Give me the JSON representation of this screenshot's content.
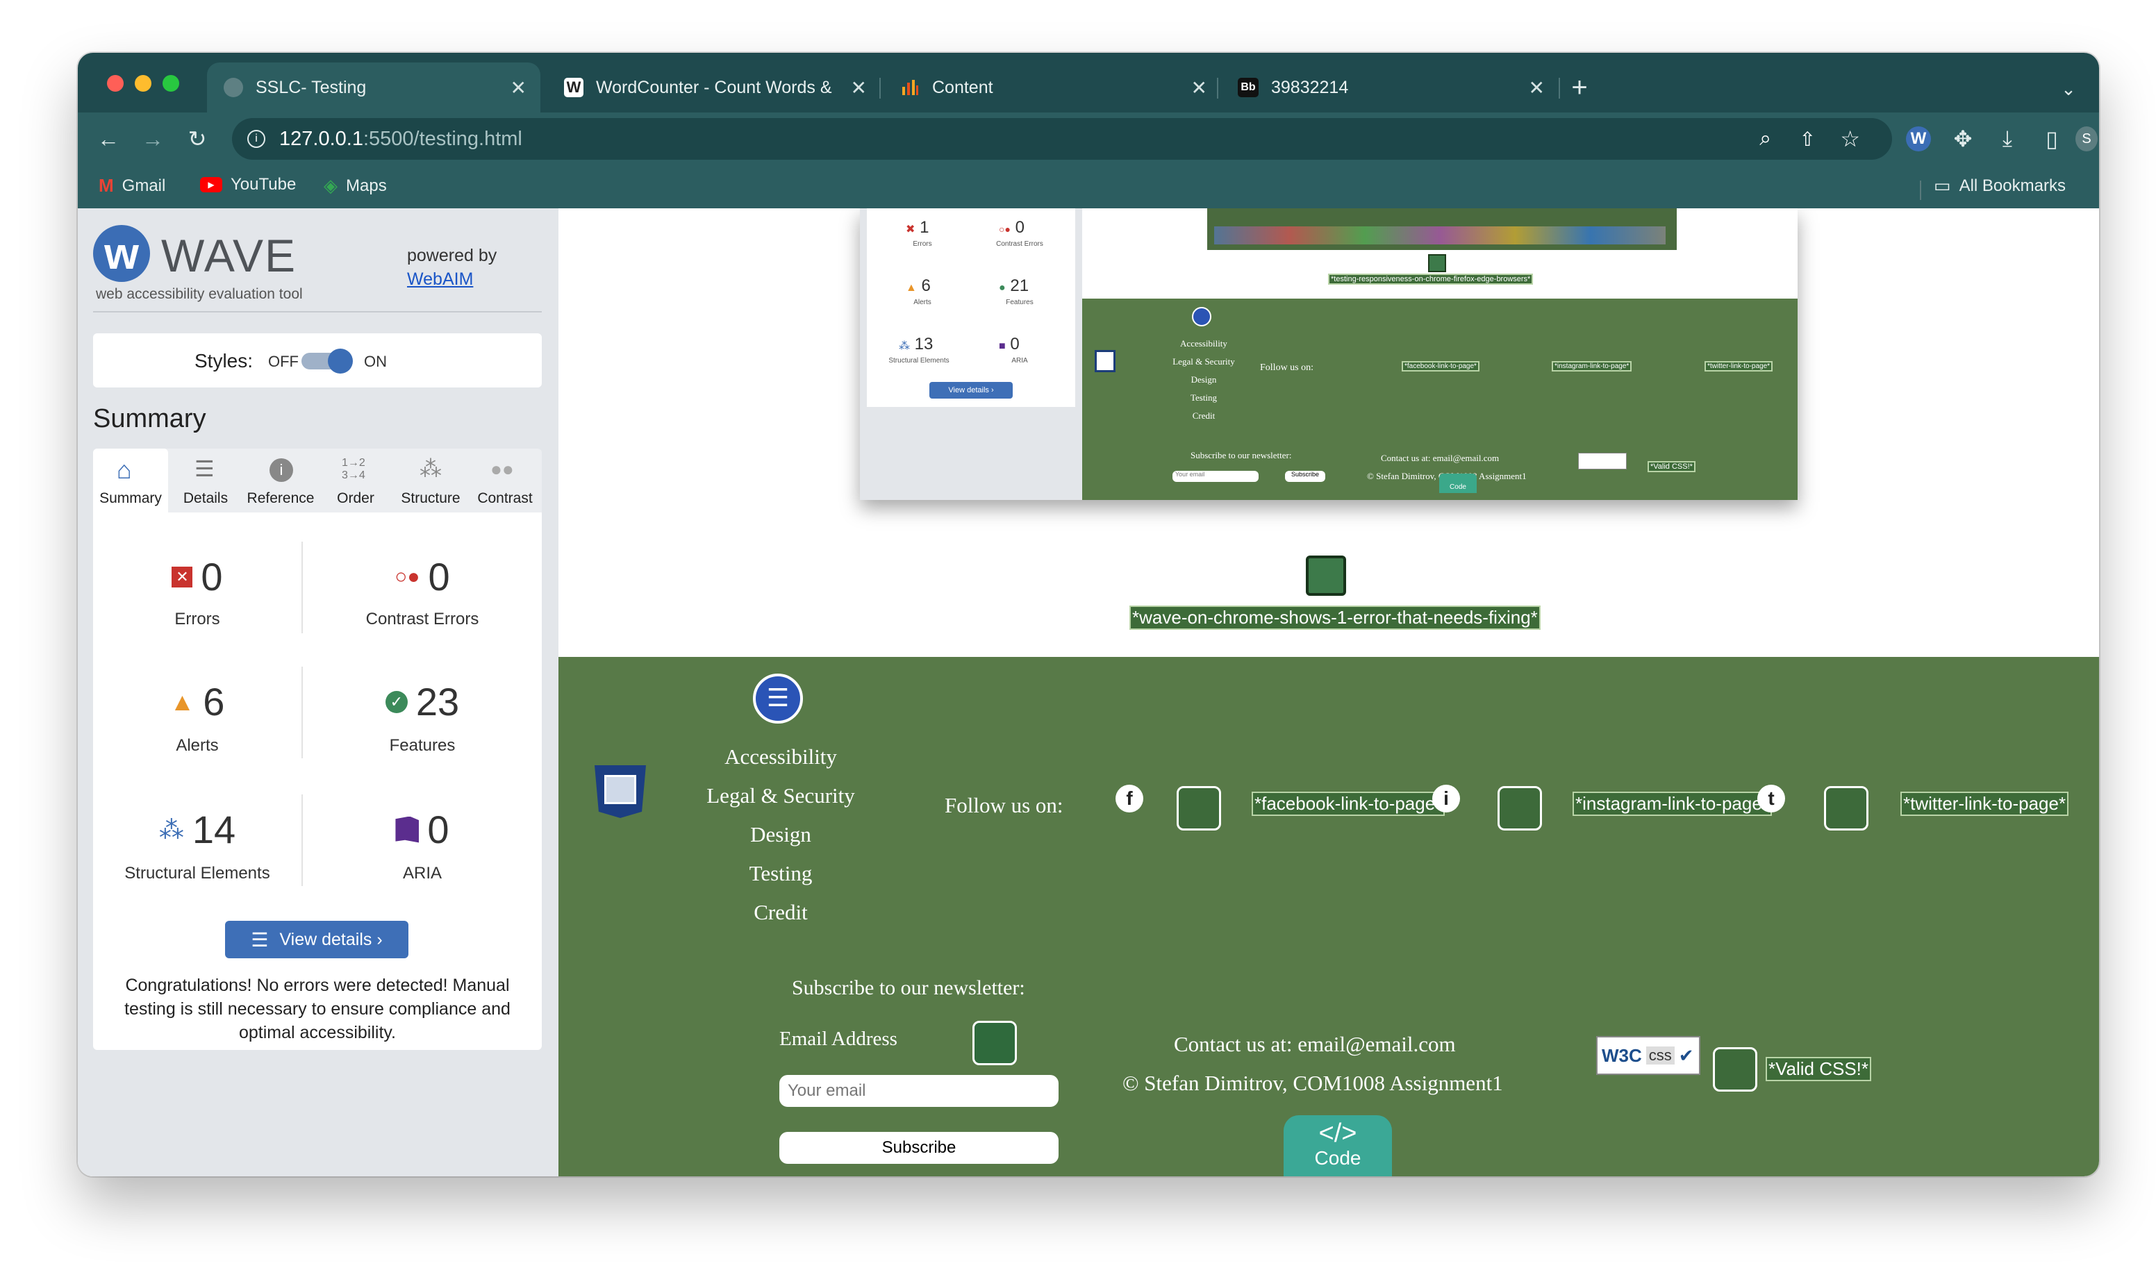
{
  "browser": {
    "tabs": [
      {
        "label": "SSLC- Testing",
        "active": true
      },
      {
        "label": "WordCounter - Count Words &",
        "active": false
      },
      {
        "label": "Content",
        "active": false
      },
      {
        "label": "39832214",
        "active": false
      }
    ],
    "new_tab": "+",
    "url": "127.0.0.1:5500/testing.html",
    "url_host": "127.0.0.1",
    "url_rest": ":5500/testing.html",
    "profile_initial": "S",
    "bookmarks": [
      "Gmail",
      "YouTube",
      "Maps"
    ],
    "all_bookmarks": "All Bookmarks"
  },
  "wave": {
    "logo": "WAVE",
    "tagline": "web accessibility evaluation tool",
    "powered_by": "powered by",
    "webaim": "WebAIM",
    "styles_label": "Styles:",
    "styles_off": "OFF",
    "styles_on": "ON",
    "summary_title": "Summary",
    "tabs": [
      "Summary",
      "Details",
      "Reference",
      "Order",
      "Structure",
      "Contrast"
    ],
    "counts": {
      "errors": {
        "value": "0",
        "label": "Errors"
      },
      "contrast": {
        "value": "0",
        "label": "Contrast Errors"
      },
      "alerts": {
        "value": "6",
        "label": "Alerts"
      },
      "features": {
        "value": "23",
        "label": "Features"
      },
      "structural": {
        "value": "14",
        "label": "Structural Elements"
      },
      "aria": {
        "value": "0",
        "label": "ARIA"
      }
    },
    "view_details": "View details ›",
    "message": "Congratulations! No errors were detected! Manual testing is still necessary to ensure compliance and optimal accessibility."
  },
  "screenshot_thumb": {
    "counts": {
      "errors": {
        "value": "1",
        "label": "Errors"
      },
      "contrast": {
        "value": "0",
        "label": "Contrast Errors"
      },
      "alerts": {
        "value": "6",
        "label": "Alerts"
      },
      "features": {
        "value": "21",
        "label": "Features"
      },
      "structural": {
        "value": "13",
        "label": "Structural Elements"
      },
      "aria": {
        "value": "0",
        "label": "ARIA"
      }
    },
    "view_details": "View details ›",
    "alt_caption": "*testing-responsiveness-on-chrome-firefox-edge-browsers*",
    "nav": [
      "Accessibility",
      "Legal & Security",
      "Design",
      "Testing",
      "Credit"
    ],
    "follow": "Follow us on:",
    "links": [
      "*facebook-link-to-page*",
      "*instagram-link-to-page*",
      "*twitter-link-to-page*"
    ],
    "subscribe_heading": "Subscribe to our newsletter:",
    "email_placeholder": "Your email",
    "subscribe_btn": "Subscribe",
    "contact": "Contact us at: email@email.com",
    "copyright": "© Stefan Dimitrov, COM1008 Assignment1",
    "valid_css": "*Valid CSS!*",
    "code": "Code"
  },
  "page": {
    "image_alt": "*wave-on-chrome-shows-1-error-that-needs-fixing*",
    "footer": {
      "nav": [
        "Accessibility",
        "Legal & Security",
        "Design",
        "Testing",
        "Credit"
      ],
      "follow": "Follow us on:",
      "links": [
        "*facebook-link-to-page*",
        "*instagram-link-to-page*",
        "*twitter-link-to-page*"
      ],
      "subscribe_heading": "Subscribe to our newsletter:",
      "email_label": "Email Address",
      "email_placeholder": "Your email",
      "subscribe_btn": "Subscribe",
      "contact": "Contact us at: email@email.com",
      "copyright": "© Stefan Dimitrov, COM1008 Assignment1",
      "w3c": "W3C",
      "css": "css",
      "valid_css": "*Valid CSS!*",
      "code_symbol": "</>",
      "code_label": "Code"
    }
  },
  "colors": {
    "chrome_dark": "#1f4a4e",
    "chrome_toolbar": "#2c5d60",
    "footer_green": "#587a48",
    "wave_blue": "#3b6db5"
  }
}
